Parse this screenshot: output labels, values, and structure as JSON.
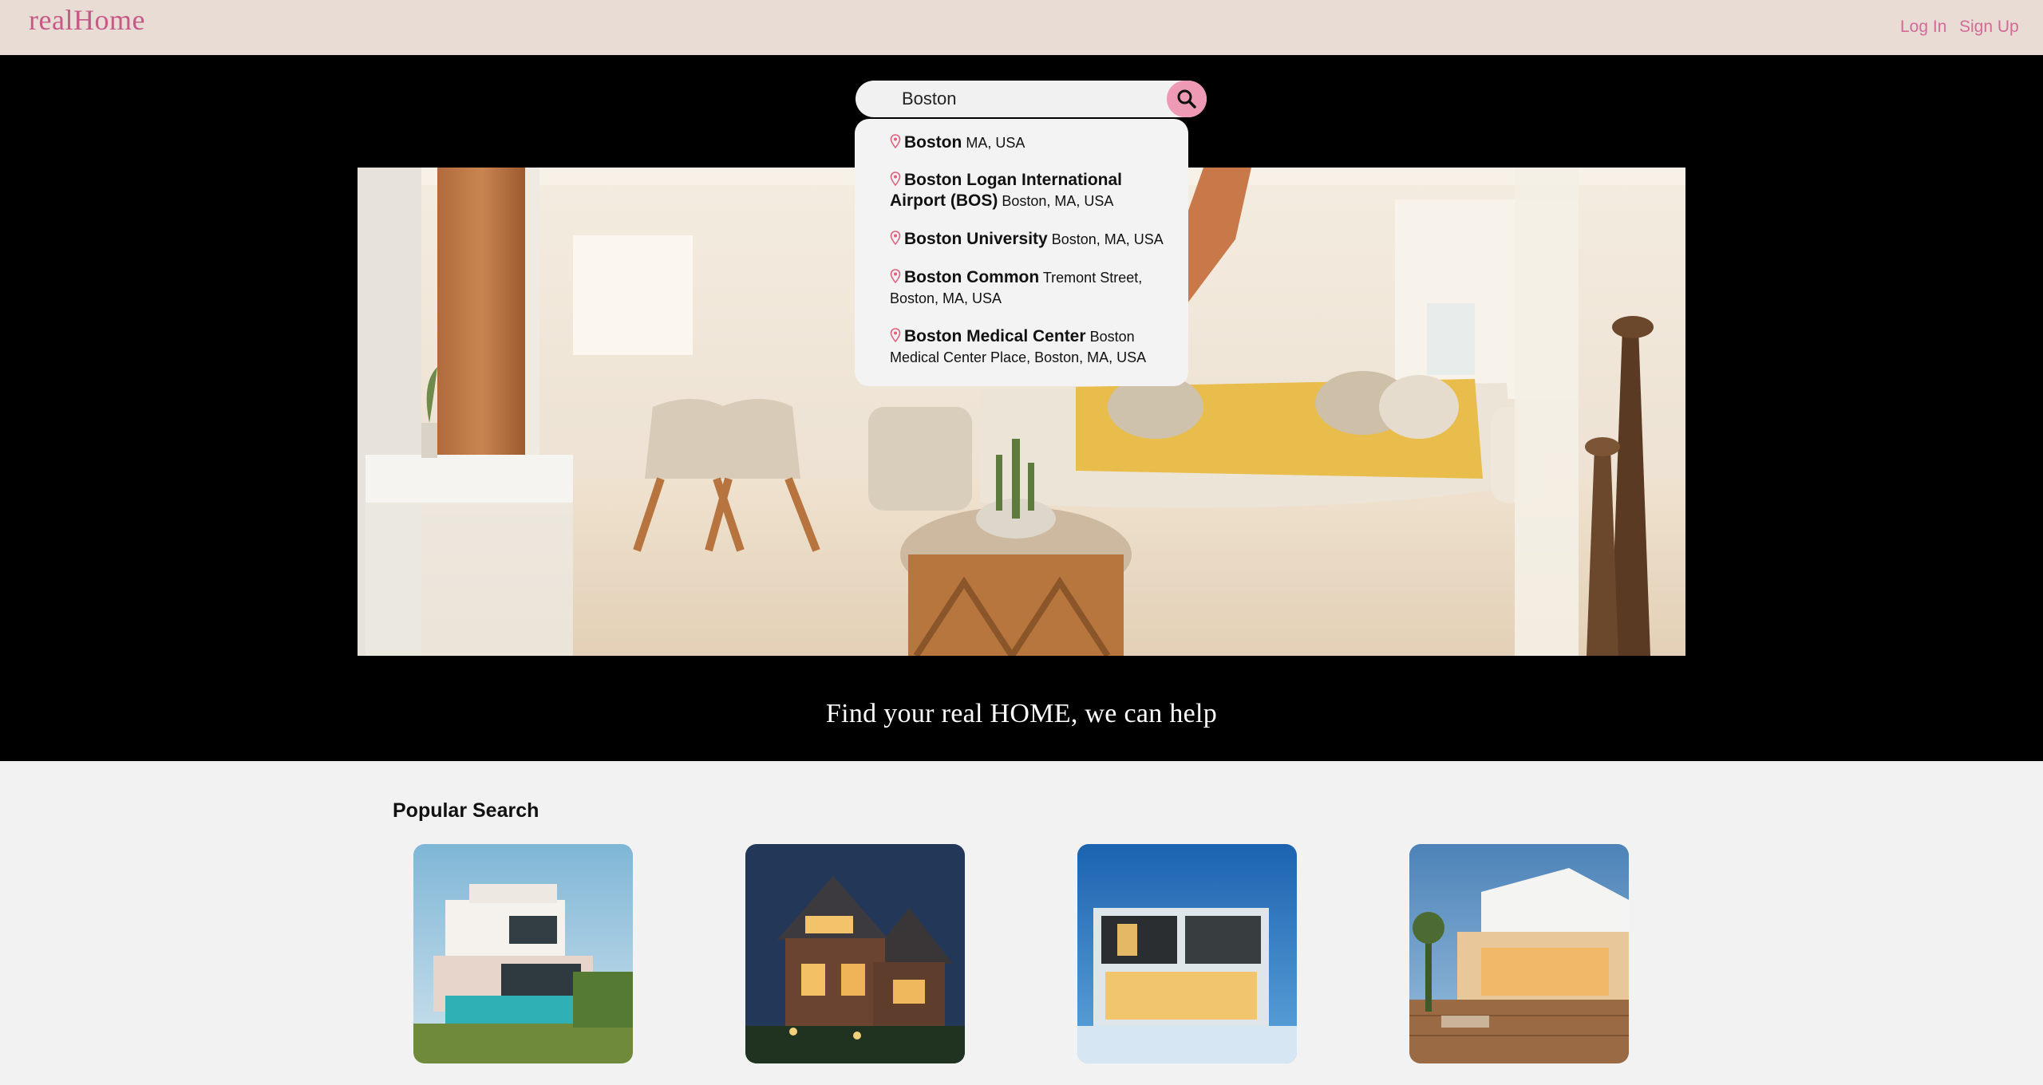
{
  "header": {
    "logo": "realHome",
    "login_label": "Log In",
    "signup_label": "Sign Up",
    "accent": "#d46a98",
    "background": "#e8dcd5"
  },
  "search": {
    "value": "Boston",
    "button_icon": "search-icon",
    "button_color": "#ef9ab4",
    "suggestions": [
      {
        "name": "Boston",
        "detail": "MA, USA"
      },
      {
        "name": "Boston Logan International Airport (BOS)",
        "detail": "Boston, MA, USA"
      },
      {
        "name": "Boston University",
        "detail": "Boston, MA, USA"
      },
      {
        "name": "Boston Common",
        "detail": "Tremont Street, Boston, MA, USA"
      },
      {
        "name": "Boston Medical Center",
        "detail": "Boston Medical Center Place, Boston, MA, USA"
      }
    ]
  },
  "hero": {
    "tagline": "Find your real HOME, we can help"
  },
  "popular": {
    "title": "Popular Search"
  }
}
